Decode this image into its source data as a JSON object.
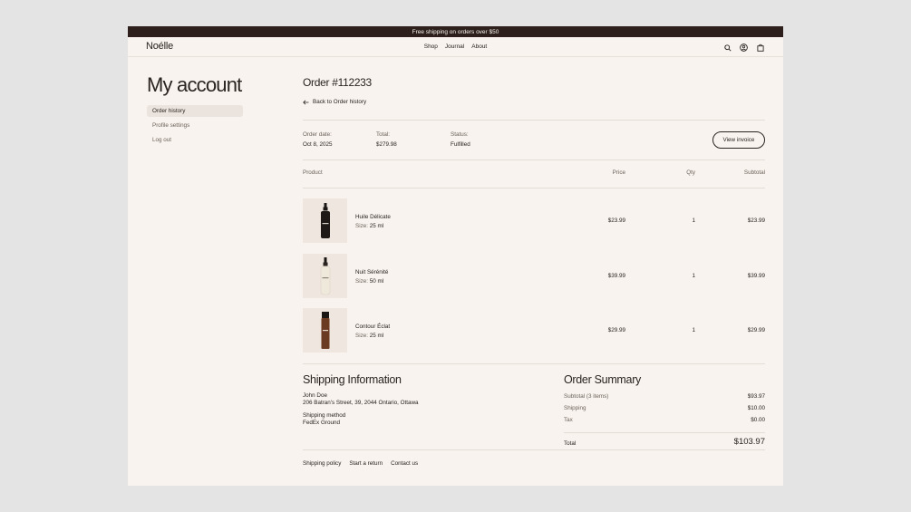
{
  "banner": {
    "text": "Free shipping on orders over $50"
  },
  "nav": {
    "logo": "Noélle",
    "links": [
      "Shop",
      "Journal",
      "About"
    ],
    "icons": [
      "search-icon",
      "user-icon",
      "bag-icon"
    ]
  },
  "sidebar": {
    "title": "My account",
    "items": [
      {
        "label": "Order history",
        "active": true
      },
      {
        "label": "Profile settings",
        "active": false
      },
      {
        "label": "Log out",
        "active": false
      }
    ]
  },
  "order": {
    "title": "Order #112233",
    "back_label": "Back to Order history",
    "meta": {
      "date_label": "Order date:",
      "date_value": "Oct 8, 2025",
      "total_label": "Total:",
      "total_value": "$279.98",
      "status_label": "Status:",
      "status_value": "Fulfilled"
    },
    "invoice_button": "View invoice",
    "columns": {
      "product": "Product",
      "price": "Price",
      "qty": "Qty",
      "subtotal": "Subtotal"
    },
    "items": [
      {
        "name": "Huile Délicate",
        "size_label": "Size:",
        "size_value": "25 ml",
        "price": "$23.99",
        "qty": "1",
        "subtotal": "$23.99"
      },
      {
        "name": "Nuit Sérénité",
        "size_label": "Size:",
        "size_value": "50 ml",
        "price": "$39.99",
        "qty": "1",
        "subtotal": "$39.99"
      },
      {
        "name": "Contour Éclat",
        "size_label": "Size:",
        "size_value": "25 ml",
        "price": "$29.99",
        "qty": "1",
        "subtotal": "$29.99"
      }
    ]
  },
  "shipping": {
    "title": "Shipping Information",
    "name": "John Doe",
    "address": "206 Batran's Street, 39, 2044 Ontario, Ottawa",
    "method_label": "Shipping method",
    "method_value": "FedEx Ground"
  },
  "summary": {
    "title": "Order Summary",
    "subtotal_label": "Subtotal (3 items)",
    "subtotal_value": "$93.97",
    "shipping_label": "Shipping",
    "shipping_value": "$10.00",
    "tax_label": "Tax",
    "tax_value": "$0.00",
    "total_label": "Total",
    "total_value": "$103.97"
  },
  "footer": {
    "links": [
      "Shipping policy",
      "Start a return",
      "Contact us"
    ]
  },
  "colors": {
    "banner": "#2c1f1c",
    "page": "#f8f3ee",
    "thumb": "#efe6df",
    "active_item": "#ebe3dd"
  }
}
